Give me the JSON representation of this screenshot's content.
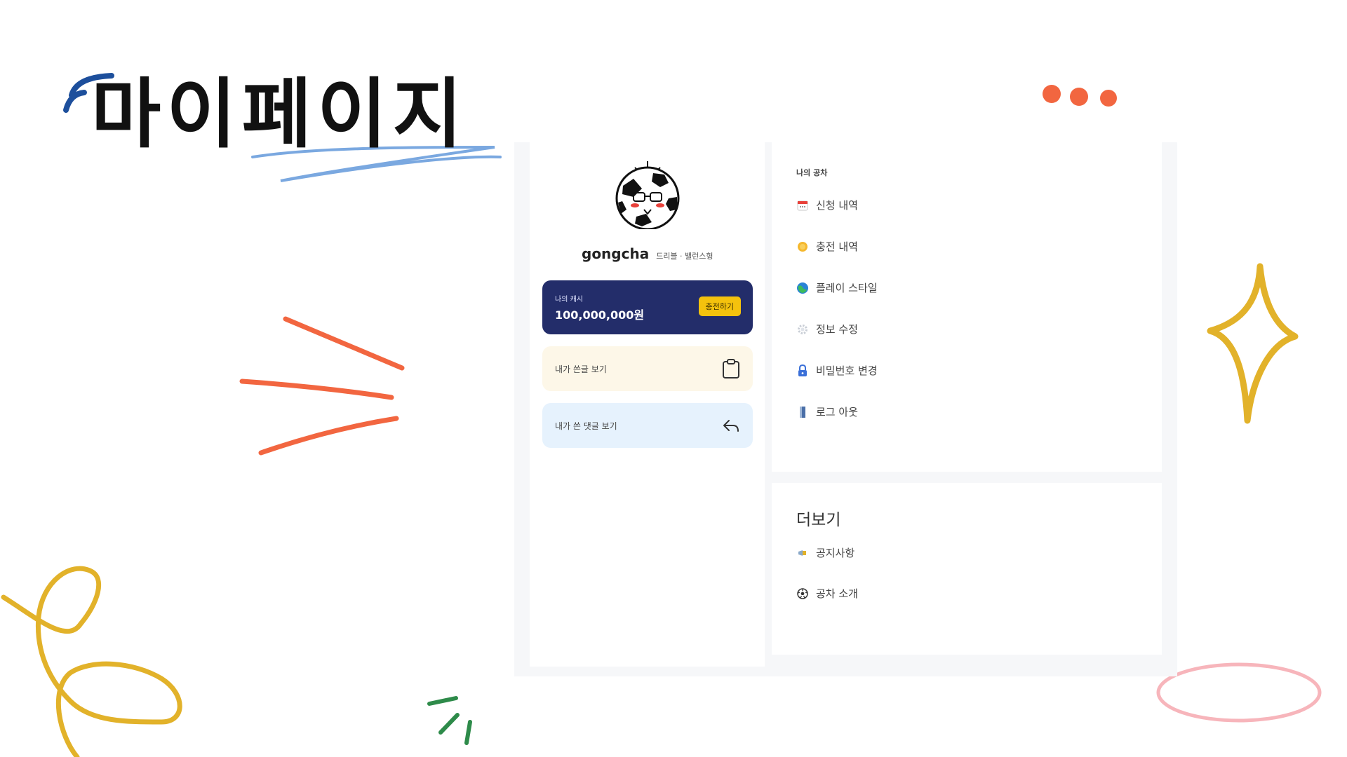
{
  "page": {
    "title": "마이페이지"
  },
  "profile": {
    "username": "gongcha",
    "user_type": "드리블 · 밸런스형"
  },
  "cash": {
    "label": "나의 캐시",
    "amount": "100,000,000원",
    "charge_label": "충전하기"
  },
  "quick_links": {
    "my_posts": "내가 쓴글 보기",
    "my_comments": "내가 쓴 댓글 보기"
  },
  "my_gongcha": {
    "section_label": "나의 공차",
    "items": [
      {
        "label": "신청 내역",
        "icon": "calendar-icon"
      },
      {
        "label": "충전 내역",
        "icon": "coin-icon"
      },
      {
        "label": "플레이 스타일",
        "icon": "globe-icon"
      },
      {
        "label": "정보 수정",
        "icon": "gear-icon"
      },
      {
        "label": "비밀번호 변경",
        "icon": "lock-icon"
      },
      {
        "label": "로그 아웃",
        "icon": "door-icon"
      }
    ]
  },
  "more": {
    "title": "더보기",
    "items": [
      {
        "label": "공지사항",
        "icon": "megaphone-icon"
      },
      {
        "label": "공차 소개",
        "icon": "soccer-ball-icon"
      }
    ]
  },
  "colors": {
    "cash_card": "#232d6a",
    "charge_button": "#f4c20d",
    "my_posts_bg": "#fdf7e8",
    "my_comments_bg": "#e6f2fd",
    "accent_orange": "#f26640",
    "accent_yellow": "#e2b22a",
    "accent_blue": "#1d4f9c",
    "accent_pink": "#f7b5bb"
  }
}
